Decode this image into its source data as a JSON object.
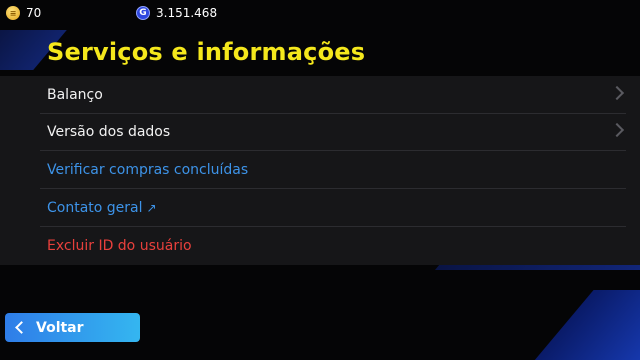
{
  "currency": {
    "coins": {
      "icon": "coin-icon",
      "value": "70"
    },
    "gp": {
      "icon": "gp-icon",
      "symbol": "G",
      "value": "3.151.468"
    }
  },
  "title": "Serviços e informações",
  "menu": {
    "items": [
      {
        "label": "Balanço",
        "color": "#f2f2f2",
        "chevron": true
      },
      {
        "label": "Versão dos dados",
        "color": "#f2f2f2",
        "chevron": true
      },
      {
        "label": "Verificar compras concluídas",
        "color": "#3d93e8"
      },
      {
        "label": "Contato geral",
        "color": "#3d93e8",
        "external_icon": "↗"
      },
      {
        "label": "Excluir ID do usuário",
        "color": "#e8403c"
      }
    ]
  },
  "back_button": {
    "label": "Voltar"
  },
  "colors": {
    "title": "#f5e81c",
    "link": "#3d93e8",
    "danger": "#e8403c",
    "button": "#2f7de8"
  }
}
